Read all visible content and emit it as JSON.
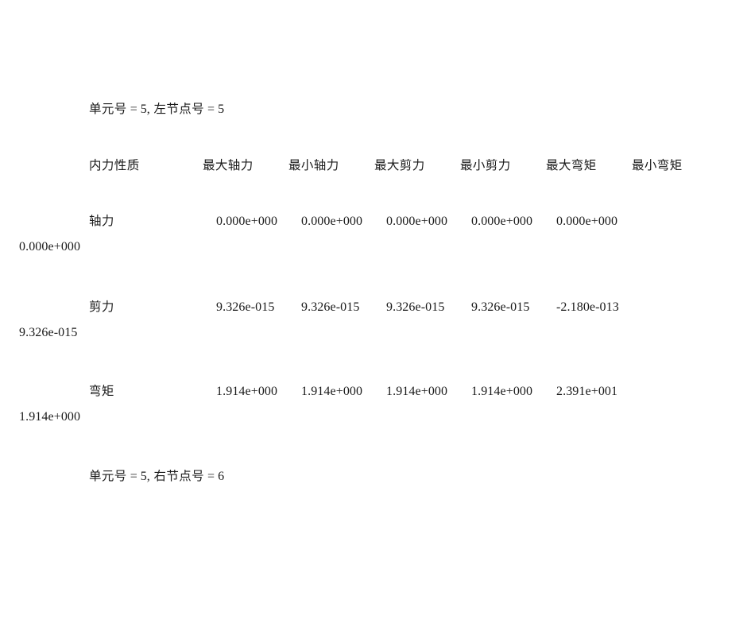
{
  "document": {
    "element_left": {
      "element_label": "单元号",
      "element_eq": " = ",
      "element_value": "5,",
      "node_label": " 左节点号",
      "node_eq": " = ",
      "node_value": "5"
    },
    "element_right": {
      "element_label": "单元号",
      "element_eq": " = ",
      "element_value": "5,",
      "node_label": " 右节点号",
      "node_eq": " = ",
      "node_value": "6"
    },
    "table": {
      "headers": [
        "内力性质",
        "最大轴力",
        "最小轴力",
        "最大剪力",
        "最小剪力",
        "最大弯矩",
        "最小弯矩"
      ],
      "rows": [
        {
          "label": "轴力",
          "values": [
            "0.000e+000",
            "0.000e+000",
            "0.000e+000",
            "0.000e+000",
            "0.000e+000",
            "0.000e+000"
          ]
        },
        {
          "label": "剪力",
          "values": [
            "9.326e-015",
            "9.326e-015",
            "9.326e-015",
            "9.326e-015",
            "-2.180e-013",
            "9.326e-015"
          ]
        },
        {
          "label": "弯矩",
          "values": [
            "1.914e+000",
            "1.914e+000",
            "1.914e+000",
            "1.914e+000",
            "2.391e+001",
            "1.914e+000"
          ]
        }
      ]
    }
  },
  "chart_data": {
    "type": "table",
    "title": "单元号 = 5 内力极值表",
    "columns": [
      "内力性质",
      "最大轴力",
      "最小轴力",
      "最大剪力",
      "最小剪力",
      "最大弯矩",
      "最小弯矩"
    ],
    "rows": [
      [
        "轴力",
        "0.000e+000",
        "0.000e+000",
        "0.000e+000",
        "0.000e+000",
        "0.000e+000",
        "0.000e+000"
      ],
      [
        "剪力",
        "9.326e-015",
        "9.326e-015",
        "9.326e-015",
        "9.326e-015",
        "-2.180e-013",
        "9.326e-015"
      ],
      [
        "弯矩",
        "1.914e+000",
        "1.914e+000",
        "1.914e+000",
        "1.914e+000",
        "2.391e+001",
        "1.914e+000"
      ]
    ]
  }
}
